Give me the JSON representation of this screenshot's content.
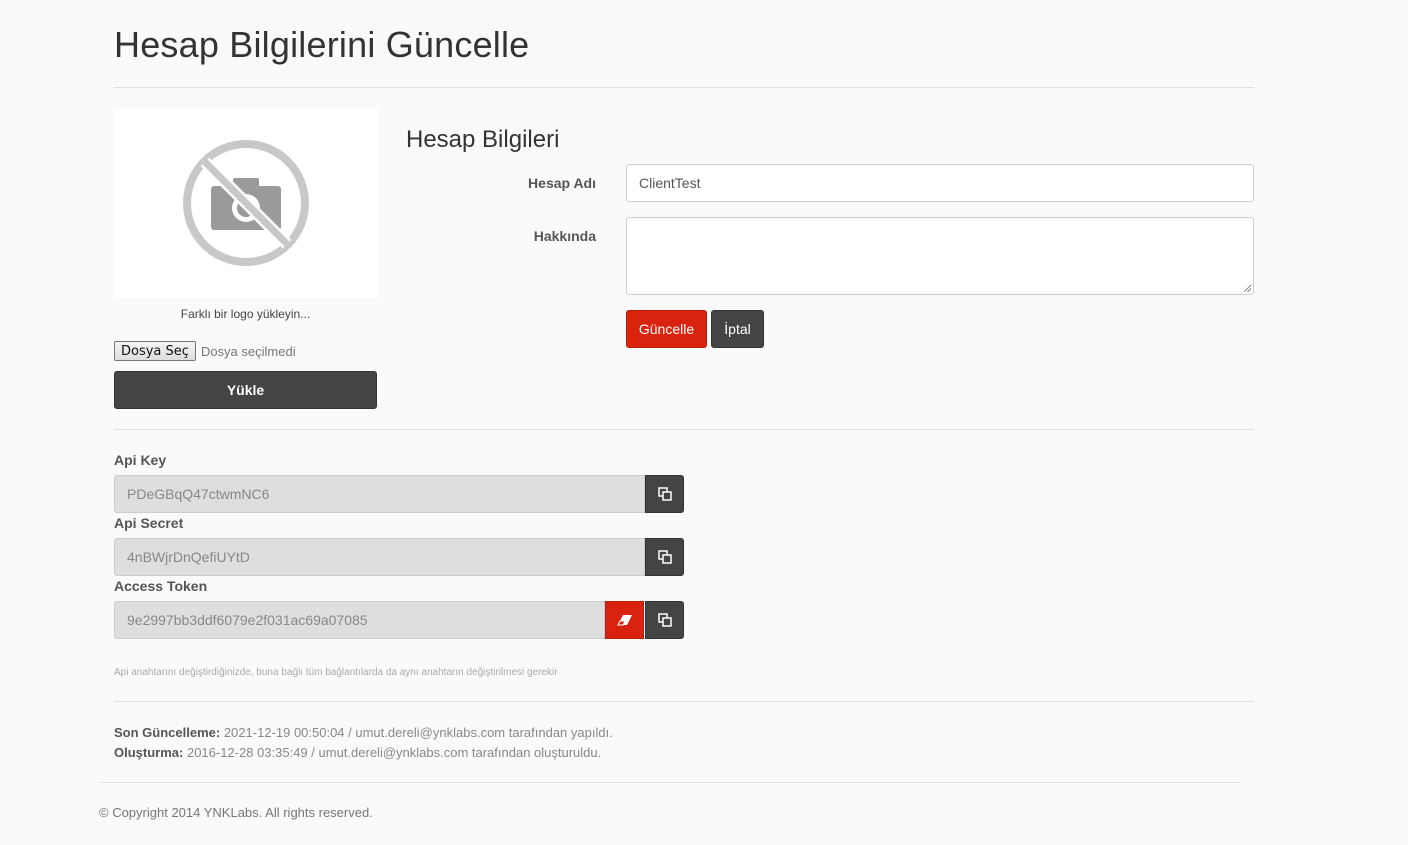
{
  "page": {
    "title": "Hesap Bilgilerini Güncelle"
  },
  "logo": {
    "icon": "no-photo-icon",
    "caption": "Farklı bir logo yükleyin...",
    "file_button_label": "Dosya Seç",
    "file_status": "Dosya seçilmedi",
    "upload_label": "Yükle"
  },
  "account": {
    "section_title": "Hesap Bilgileri",
    "name_label": "Hesap Adı",
    "name_value": "ClientTest",
    "about_label": "Hakkında",
    "about_value": "",
    "update_label": "Güncelle",
    "cancel_label": "İptal"
  },
  "api": {
    "key_label": "Api Key",
    "key_value": "PDeGBqQ47ctwmNC6",
    "secret_label": "Api Secret",
    "secret_value": "4nBWjrDnQefiUYtD",
    "token_label": "Access Token",
    "token_value": "9e2997bb3ddf6079e2f031ac69a07085",
    "note": "Api anahtarını değiştirdiğinizde, buna bağlı tüm bağlantılarda da aynı anahtarın değiştirilmesi gerekir"
  },
  "meta": {
    "updated_label": "Son Güncelleme:",
    "updated_value": "2021-12-19 00:50:04 / umut.dereli@ynklabs.com tarafından yapıldı.",
    "created_label": "Oluşturma:",
    "created_value": "2016-12-28 03:35:49 / umut.dereli@ynklabs.com tarafından oluşturuldu."
  },
  "footer": {
    "copyright": "© Copyright 2014 YNKLabs. All rights reserved."
  },
  "colors": {
    "accent": "#d9230f",
    "dark": "#444444"
  }
}
